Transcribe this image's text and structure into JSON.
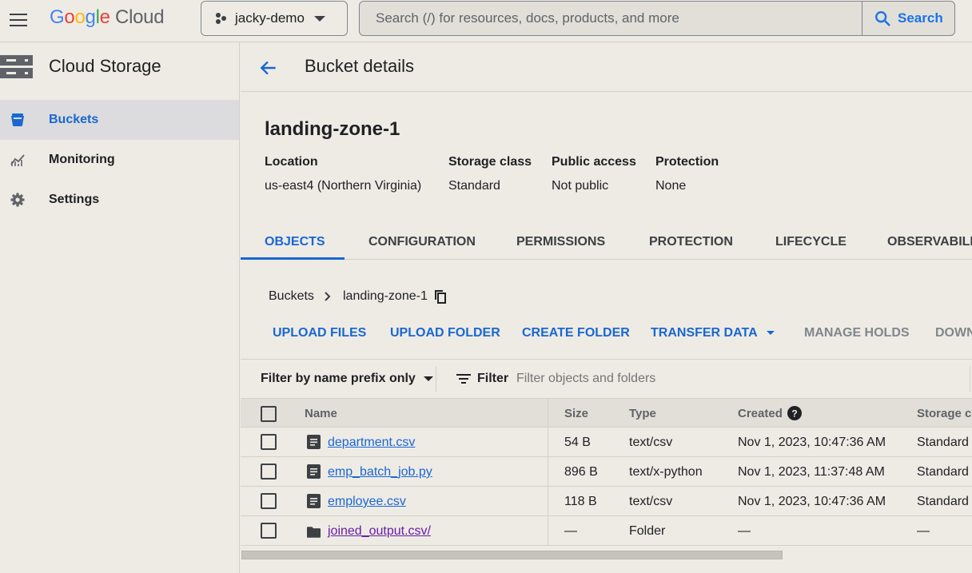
{
  "topbar": {
    "logo": {
      "g1": "G",
      "g2": "o",
      "g3": "o",
      "g4": "g",
      "g5": "l",
      "g6": "e",
      "cloud": "Cloud"
    },
    "project": "jacky-demo",
    "search_placeholder": "Search (/) for resources, docs, products, and more",
    "search_button": "Search"
  },
  "sidebar": {
    "title": "Cloud Storage",
    "items": [
      {
        "label": "Buckets",
        "icon": "bucket-icon"
      },
      {
        "label": "Monitoring",
        "icon": "monitoring-icon"
      },
      {
        "label": "Settings",
        "icon": "gear-icon"
      }
    ]
  },
  "header": {
    "title": "Bucket details"
  },
  "bucket": {
    "name": "landing-zone-1",
    "props": [
      {
        "label": "Location",
        "value": "us-east4 (Northern Virginia)"
      },
      {
        "label": "Storage class",
        "value": "Standard"
      },
      {
        "label": "Public access",
        "value": "Not public"
      },
      {
        "label": "Protection",
        "value": "None"
      }
    ]
  },
  "tabs": [
    "OBJECTS",
    "CONFIGURATION",
    "PERMISSIONS",
    "PROTECTION",
    "LIFECYCLE",
    "OBSERVABILITY"
  ],
  "breadcrumb": {
    "root": "Buckets",
    "current": "landing-zone-1"
  },
  "actions": [
    "UPLOAD FILES",
    "UPLOAD FOLDER",
    "CREATE FOLDER",
    "TRANSFER DATA",
    "MANAGE HOLDS",
    "DOWNLOAD"
  ],
  "filter": {
    "mode": "Filter by name prefix only",
    "label": "Filter",
    "placeholder": "Filter objects and folders"
  },
  "table": {
    "columns": [
      "Name",
      "Size",
      "Type",
      "Created",
      "Storage class"
    ],
    "rows": [
      {
        "name": "department.csv",
        "size": "54 B",
        "type": "text/csv",
        "created": "Nov 1, 2023, 10:47:36 AM",
        "storage": "Standard"
      },
      {
        "name": "emp_batch_job.py",
        "size": "896 B",
        "type": "text/x-python",
        "created": "Nov 1, 2023, 11:37:48 AM",
        "storage": "Standard"
      },
      {
        "name": "employee.csv",
        "size": "118 B",
        "type": "text/csv",
        "created": "Nov 1, 2023, 10:47:36 AM",
        "storage": "Standard"
      },
      {
        "name": "joined_output.csv/",
        "size": "—",
        "type": "Folder",
        "created": "—",
        "storage": "—"
      }
    ]
  },
  "colors": {
    "accent": "#1967d2",
    "visited_link": "#681da8",
    "background": "#eeebe5"
  }
}
